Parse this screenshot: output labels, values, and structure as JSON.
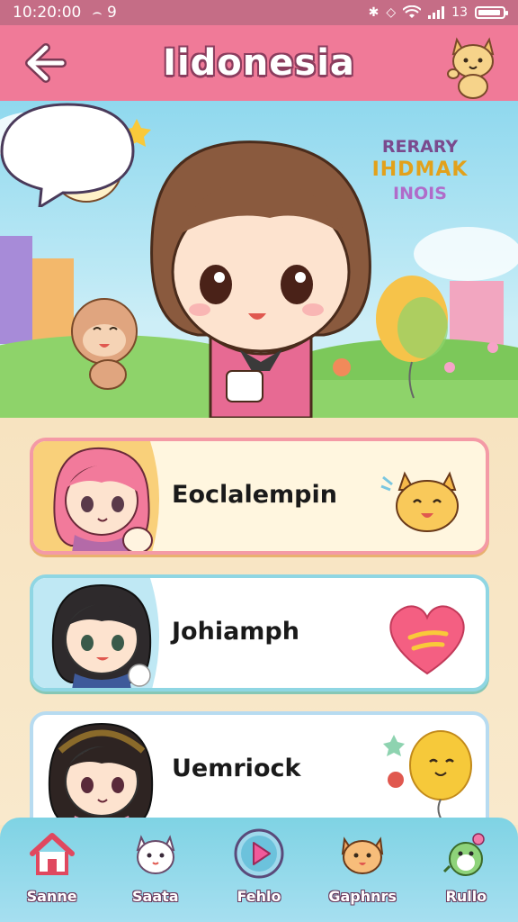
{
  "status_bar": {
    "time": "10:20:00",
    "extra": "⌢ 9",
    "signal_text": "13"
  },
  "header": {
    "title": "Iidonesia",
    "back_icon": "arrow-left-icon",
    "mascot": "cat-mascot-icon"
  },
  "hero": {
    "speech_bubble": {
      "line1": "RERARY",
      "line2": "IHDMAK",
      "line3": "INOIS"
    }
  },
  "cards": [
    {
      "label": "Eoclalempin",
      "avatar": "pink-hair-girl",
      "decoration": "cat-face-icon"
    },
    {
      "label": "Johiamph",
      "avatar": "black-hair-girl",
      "decoration": "heart-icon"
    },
    {
      "label": "Uemriock",
      "avatar": "brown-hair-girl",
      "decoration": "balloon-icon"
    }
  ],
  "nav": [
    {
      "label": "Sanne",
      "icon": "home-icon"
    },
    {
      "label": "Saata",
      "icon": "cat-icon"
    },
    {
      "label": "Fehlo",
      "icon": "play-icon"
    },
    {
      "label": "Gaphnrs",
      "icon": "dog-icon"
    },
    {
      "label": "Rullo",
      "icon": "dino-icon"
    }
  ],
  "colors": {
    "header": "#f07a98",
    "status_bar": "#c56d86",
    "nav": "#7fd3e4"
  }
}
